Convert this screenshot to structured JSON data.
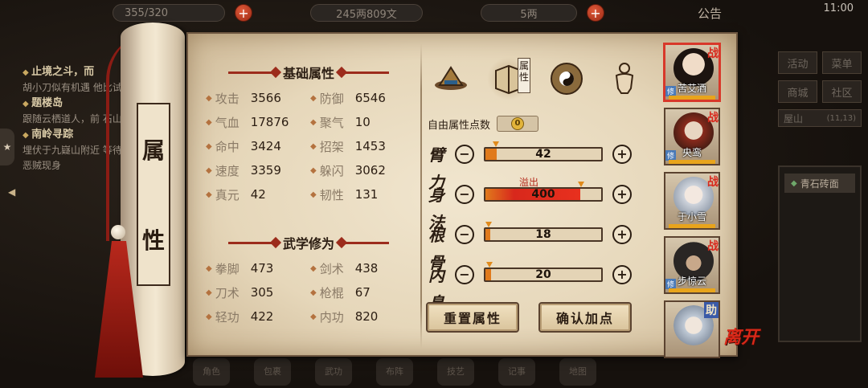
{
  "top_bar": {
    "resource1": "355/320",
    "resource2": "245两809文",
    "resource3": "5两",
    "notice": "公告",
    "clock": "11:00"
  },
  "background": {
    "quests": [
      {
        "title": "止境之斗，而",
        "desc": "胡小刀似有机遇 他比试"
      },
      {
        "title": "题楼岛",
        "desc": "跟随云栖道人，前 石山"
      },
      {
        "title": "南岭寻踪",
        "desc": "埋伏于九嶷山附近 等待恶贼现身"
      }
    ],
    "menu": [
      [
        "活动",
        "菜单"
      ],
      [
        "商城",
        "社区"
      ]
    ],
    "location": "屋山",
    "coords": "(11,13)",
    "tile": "青石砖面",
    "dock": [
      "角色",
      "包裹",
      "武功",
      "布阵",
      "技艺",
      "记事",
      "地图"
    ]
  },
  "panel": {
    "scroll_title_1": "属",
    "scroll_title_2": "性",
    "basic_title": "基础属性",
    "basic_stats": [
      {
        "k": "攻击",
        "v": "3566"
      },
      {
        "k": "防御",
        "v": "6546"
      },
      {
        "k": "气血",
        "v": "17876"
      },
      {
        "k": "聚气",
        "v": "10"
      },
      {
        "k": "命中",
        "v": "3424"
      },
      {
        "k": "招架",
        "v": "1453"
      },
      {
        "k": "速度",
        "v": "3359"
      },
      {
        "k": "躲闪",
        "v": "3062"
      },
      {
        "k": "真元",
        "v": "42"
      },
      {
        "k": "韧性",
        "v": "131"
      }
    ],
    "martial_title": "武学修为",
    "martial_stats": [
      {
        "k": "拳脚",
        "v": "473"
      },
      {
        "k": "剑术",
        "v": "438"
      },
      {
        "k": "刀术",
        "v": "305"
      },
      {
        "k": "枪棍",
        "v": "67"
      },
      {
        "k": "轻功",
        "v": "422"
      },
      {
        "k": "内功",
        "v": "820"
      }
    ],
    "attr_tab_label": "属性",
    "free_points_label": "自由属性点数",
    "free_points_value": "0",
    "overflow_label": "溢出",
    "attributes": [
      {
        "label": "臂力",
        "value": "42",
        "fill": 0.1
      },
      {
        "label": "身法",
        "value": "400",
        "fill": 0.82
      },
      {
        "label": "根骨",
        "value": "18",
        "fill": 0.04
      },
      {
        "label": "内息",
        "value": "20",
        "fill": 0.05
      }
    ],
    "reset_button": "重置属性",
    "confirm_button": "确认加点"
  },
  "party": [
    {
      "name": "苦艾酒",
      "badge": "战",
      "role": "修",
      "hp": 1.0
    },
    {
      "name": "央鸾",
      "badge": "战",
      "role": "修",
      "hp": 1.0
    },
    {
      "name": "于小雪",
      "badge": "战",
      "role": "",
      "hp": 1.0
    },
    {
      "name": "步惊云",
      "badge": "战",
      "role": "修",
      "hp": 1.0
    },
    {
      "name": "",
      "badge": "助",
      "role": "",
      "hp": 1.0
    }
  ],
  "leave_label": "离开",
  "colors": {
    "accent_red": "#d8281c",
    "bar_orange": "#e07a1c",
    "paper": "#e6d7ba"
  }
}
